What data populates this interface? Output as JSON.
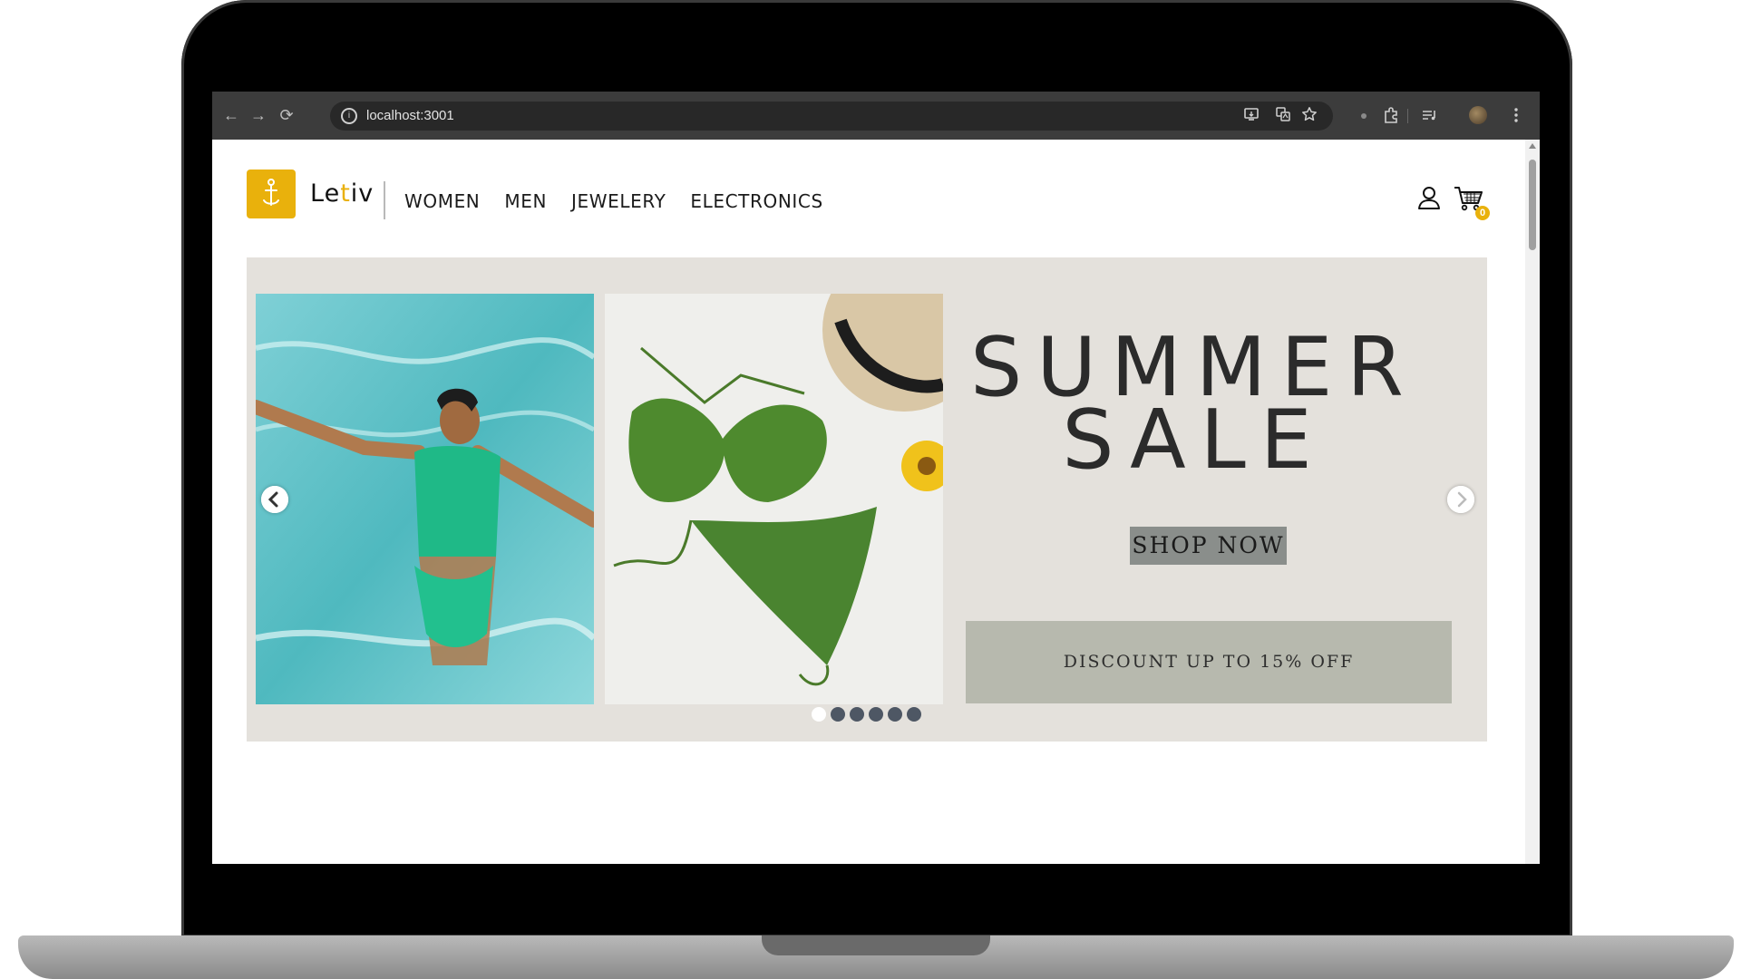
{
  "browser": {
    "url": "localhost:3001",
    "back_icon": "←",
    "forward_icon": "→",
    "reload_icon": "⟳"
  },
  "header": {
    "brand_prefix": "Le",
    "brand_accent": "t",
    "brand_suffix": "iv",
    "menu": [
      {
        "label": "WOMEN"
      },
      {
        "label": "MEN"
      },
      {
        "label": "JEWELERY"
      },
      {
        "label": "ELECTRONICS"
      }
    ],
    "cart_count": "0"
  },
  "banner": {
    "headline_line1": "SUMMER",
    "headline_line2": "SALE",
    "cta_label": "SHOP NOW",
    "discount_text": "DISCOUNT UP TO 15% OFF",
    "slide_count": 6,
    "active_slide": 1
  },
  "colors": {
    "accent": "#e9b10c",
    "banner_bg": "#e4e1dc",
    "cta_bg": "#8a8e8b",
    "discount_bg": "#b7b9ae"
  }
}
